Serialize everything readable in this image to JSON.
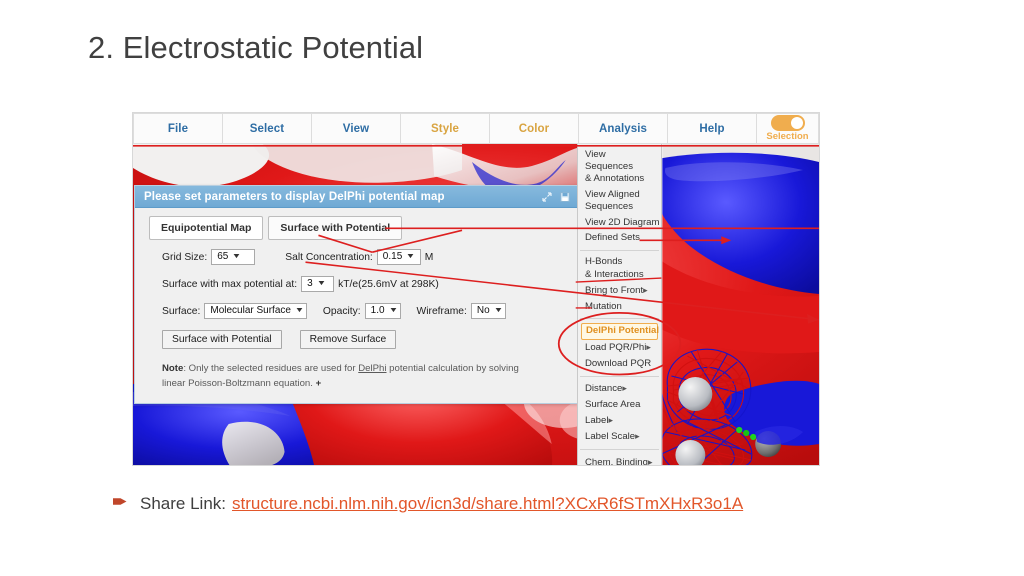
{
  "slide": {
    "title": "2. Electrostatic Potential"
  },
  "menubar": {
    "items": [
      {
        "label": "File",
        "style": "blue"
      },
      {
        "label": "Select",
        "style": "blue"
      },
      {
        "label": "View",
        "style": "blue"
      },
      {
        "label": "Style",
        "style": "tan"
      },
      {
        "label": "Color",
        "style": "tan"
      },
      {
        "label": "Analysis",
        "style": "blue"
      },
      {
        "label": "Help",
        "style": "blue"
      }
    ],
    "toggle": {
      "label": "Selection",
      "state": "on",
      "color": "#f0ad4e"
    }
  },
  "analysis_menu": {
    "items": [
      {
        "label": "View Sequences\n& Annotations",
        "submenu": false,
        "highlight": false
      },
      {
        "label": "View Aligned\nSequences",
        "submenu": false,
        "highlight": false
      },
      {
        "label": "View 2D Diagram",
        "submenu": false,
        "highlight": false
      },
      {
        "label": "Defined Sets",
        "submenu": false,
        "highlight": false
      },
      {
        "label": "H-Bonds\n& Interactions",
        "submenu": false,
        "highlight": false
      },
      {
        "label": "Bring to Front",
        "submenu": true,
        "highlight": false
      },
      {
        "label": "Mutation",
        "submenu": false,
        "highlight": false
      },
      {
        "label": "DelPhi Potential",
        "submenu": false,
        "highlight": true
      },
      {
        "label": "Load PQR/Phi",
        "submenu": true,
        "highlight": false
      },
      {
        "label": "Download PQR",
        "submenu": false,
        "highlight": false
      },
      {
        "label": "Distance",
        "submenu": true,
        "highlight": false
      },
      {
        "label": "Surface Area",
        "submenu": false,
        "highlight": false
      },
      {
        "label": "Label",
        "submenu": true,
        "highlight": false
      },
      {
        "label": "Label Scale",
        "submenu": true,
        "highlight": false
      },
      {
        "label": "Chem. Binding",
        "submenu": true,
        "highlight": false
      }
    ],
    "highlight_color": "#f0ad4e"
  },
  "dialog": {
    "title": "Please set parameters to display DelPhi potential map",
    "header_color": "#7bb2d8",
    "icons": [
      {
        "name": "resize-icon",
        "glyph": "expand-arrow"
      },
      {
        "name": "save-icon",
        "glyph": "floppy-disk"
      }
    ],
    "tabs": [
      {
        "label": "Equipotential Map",
        "selected": true
      },
      {
        "label": "Surface with Potential",
        "selected": false
      }
    ],
    "fields": {
      "grid_size": {
        "label": "Grid Size:",
        "value": "65"
      },
      "salt_concentration": {
        "label": "Salt Concentration:",
        "value": "0.15",
        "unit": "M"
      },
      "max_potential": {
        "label": "Surface with max potential at:",
        "value": "3",
        "unit": "kT/e(25.6mV at 298K)"
      },
      "surface": {
        "label": "Surface:",
        "value": "Molecular Surface"
      },
      "opacity": {
        "label": "Opacity:",
        "value": "1.0"
      },
      "wireframe": {
        "label": "Wireframe:",
        "value": "No"
      }
    },
    "buttons": [
      {
        "label": "Surface with Potential"
      },
      {
        "label": "Remove Surface"
      }
    ],
    "note": {
      "prefix": "Note",
      "text_1": ": Only the selected residues are used for ",
      "link": "DelPhi",
      "text_2": " potential calculation by solving linear Poisson-Boltzmann equation.",
      "expander": "+"
    }
  },
  "share": {
    "label": "Share Link:",
    "url": "structure.ncbi.nlm.nih.gov/icn3d/share.html?XCxR6fSTmXHxR3o1A",
    "url_color": "#e2562a",
    "bullet": "arrow-bullet-icon"
  },
  "viewer": {
    "description": "electrostatic-potential-molecular-surface",
    "positive_color": "#1818d8",
    "negative_color": "#e01818",
    "neutral_color": "#f0f0f0",
    "mesh_colors": [
      "#d01010",
      "#1414cc"
    ]
  }
}
